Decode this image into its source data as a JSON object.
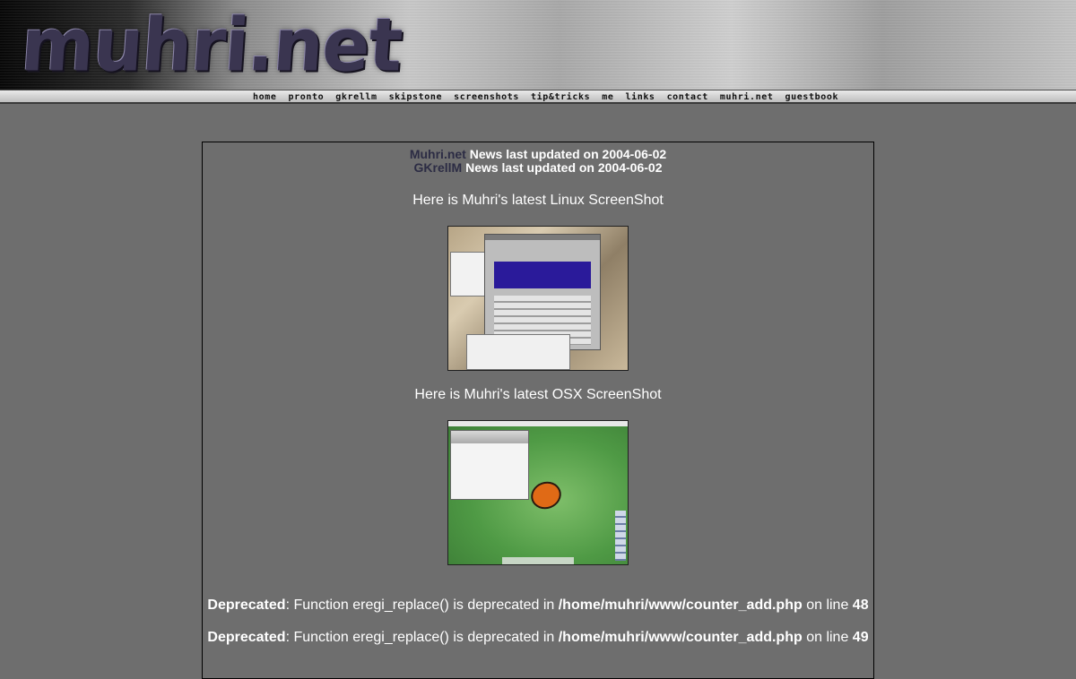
{
  "header": {
    "logo_text": "muhri.net"
  },
  "nav": {
    "items": [
      "home",
      "pronto",
      "gkrellm",
      "skipstone",
      "screenshots",
      "tip&tricks",
      "me",
      "links",
      "contact",
      "muhri.net",
      "guestbook"
    ]
  },
  "news": {
    "line1_site": "Muhri.net",
    "line1_text": "News last updated on 2004-06-02",
    "line2_site": "GKrellM",
    "line2_text": "News last updated on 2004-06-02"
  },
  "shots": {
    "linux_caption": "Here is Muhri's latest Linux ScreenShot",
    "osx_caption": "Here is Muhri's latest OSX ScreenShot"
  },
  "warnings": [
    {
      "label": "Deprecated",
      "message": ": Function eregi_replace() is deprecated in ",
      "path": "/home/muhri/www/counter_add.php",
      "on_line": " on line ",
      "line": "48"
    },
    {
      "label": "Deprecated",
      "message": ": Function eregi_replace() is deprecated in ",
      "path": "/home/muhri/www/counter_add.php",
      "on_line": " on line ",
      "line": "49"
    }
  ],
  "colors": {
    "background": "#6e6e6e",
    "site_name": "#2c2c44"
  }
}
